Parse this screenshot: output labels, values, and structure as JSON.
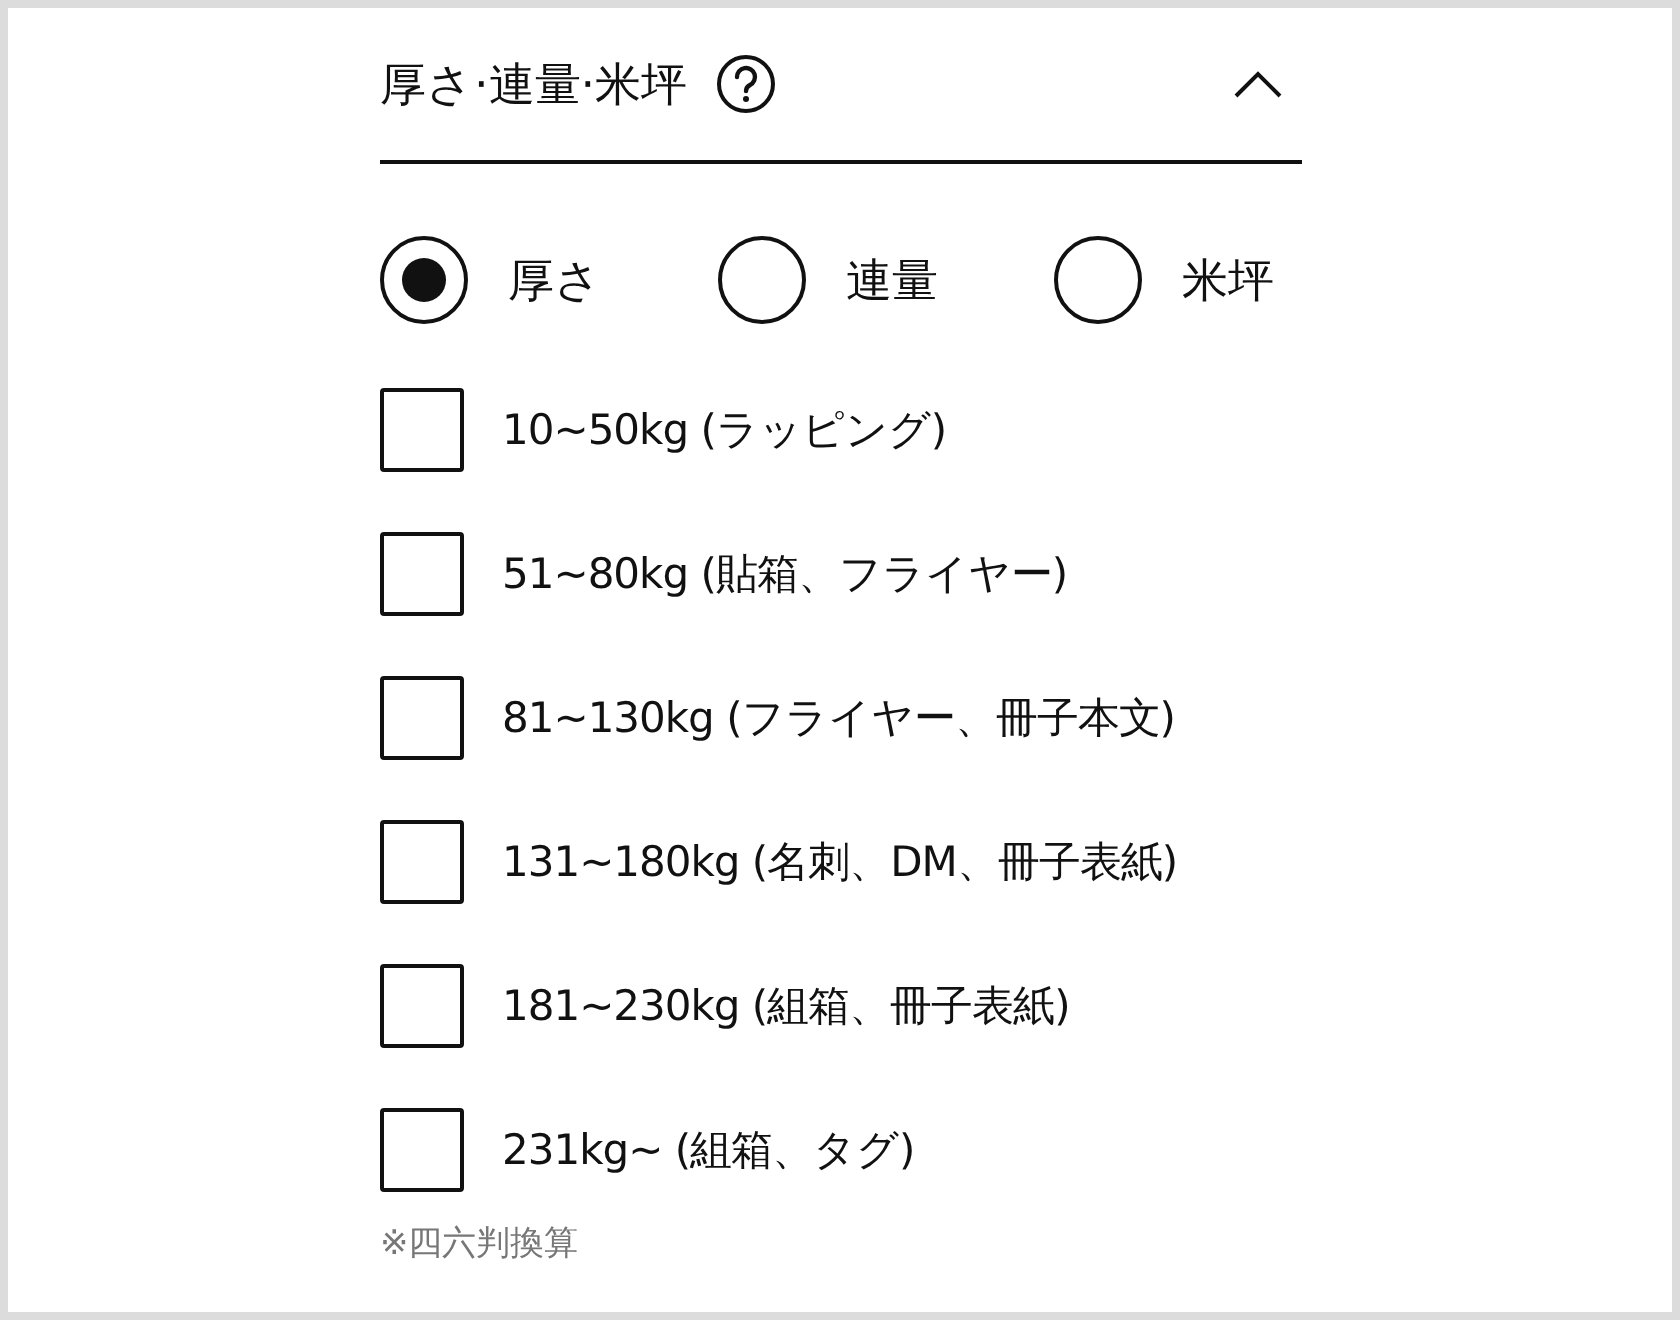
{
  "section": {
    "title": "厚さ·連量·米坪",
    "expanded": true
  },
  "units": [
    {
      "label": "厚さ",
      "selected": true
    },
    {
      "label": "連量",
      "selected": false
    },
    {
      "label": "米坪",
      "selected": false
    }
  ],
  "options": [
    {
      "label": "10~50kg (ラッピング)",
      "checked": false
    },
    {
      "label": "51~80kg (貼箱、フライヤー)",
      "checked": false
    },
    {
      "label": "81~130kg (フライヤー、冊子本文)",
      "checked": false
    },
    {
      "label": "131~180kg (名刺、DM、冊子表紙)",
      "checked": false
    },
    {
      "label": "181~230kg (組箱、冊子表紙)",
      "checked": false
    },
    {
      "label": "231kg~ (組箱、タグ)",
      "checked": false
    }
  ],
  "note": "※四六判換算"
}
